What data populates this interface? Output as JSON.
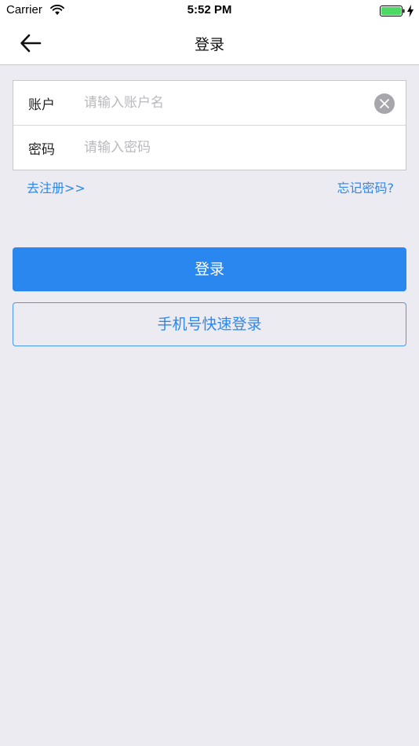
{
  "status_bar": {
    "carrier": "Carrier",
    "time": "5:52 PM",
    "battery_color": "#4cd964"
  },
  "nav": {
    "back_icon": "arrow-left-icon",
    "title": "登录"
  },
  "form": {
    "account": {
      "label": "账户",
      "placeholder": "请输入账户名",
      "value": ""
    },
    "password": {
      "label": "密码",
      "placeholder": "请输入密码",
      "value": ""
    },
    "clear_icon": "clear-icon"
  },
  "links": {
    "register": "去注册>>",
    "forgot": "忘记密码?"
  },
  "buttons": {
    "login": "登录",
    "phone_login": "手机号快速登录"
  },
  "colors": {
    "accent": "#2a87ef",
    "background": "#ebebf1"
  }
}
